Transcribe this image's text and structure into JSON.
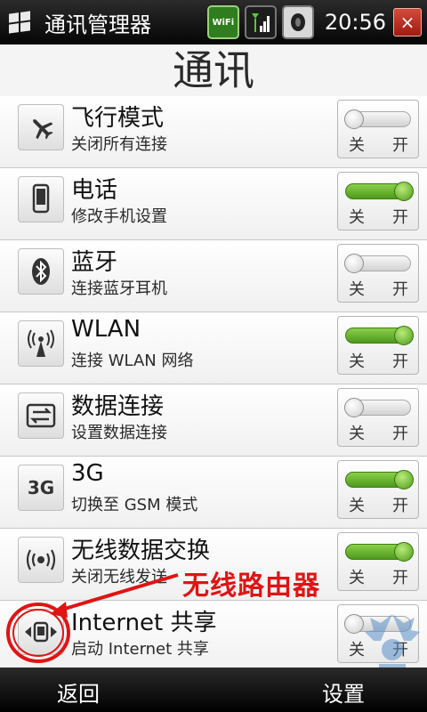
{
  "status_bar": {
    "app_title": "通讯管理器",
    "wifi_label": "WiFi",
    "time": "20:56",
    "close_label": "×"
  },
  "page_title": "通讯",
  "rows": [
    {
      "title": "飞行模式",
      "subtitle": "关闭所有连接",
      "state": "off",
      "off_label": "关",
      "on_label": "开",
      "icon": "airplane-icon"
    },
    {
      "title": "电话",
      "subtitle": "修改手机设置",
      "state": "on",
      "off_label": "关",
      "on_label": "开",
      "icon": "phone-icon"
    },
    {
      "title": "蓝牙",
      "subtitle": "连接蓝牙耳机",
      "state": "off",
      "off_label": "关",
      "on_label": "开",
      "icon": "bluetooth-icon"
    },
    {
      "title": "WLAN",
      "subtitle": "连接 WLAN 网络",
      "state": "on",
      "off_label": "关",
      "on_label": "开",
      "icon": "wlan-antenna-icon"
    },
    {
      "title": "数据连接",
      "subtitle": "设置数据连接",
      "state": "off",
      "off_label": "关",
      "on_label": "开",
      "icon": "data-transfer-icon"
    },
    {
      "title": "3G",
      "subtitle": "切换至 GSM 模式",
      "state": "on",
      "off_label": "关",
      "on_label": "开",
      "icon": "3g-icon",
      "icon_text": "3G"
    },
    {
      "title": "无线数据交换",
      "subtitle": "关闭无线发送",
      "state": "on",
      "off_label": "关",
      "on_label": "开",
      "icon": "wireless-beam-icon"
    },
    {
      "title": "Internet 共享",
      "subtitle": "启动 Internet 共享",
      "state": "off",
      "off_label": "关",
      "on_label": "开",
      "icon": "internet-sharing-icon"
    }
  ],
  "annotation": {
    "text": "无线路由器",
    "color": "#e01414"
  },
  "bottom_bar": {
    "left_softkey": "返回",
    "right_softkey": "设置"
  }
}
